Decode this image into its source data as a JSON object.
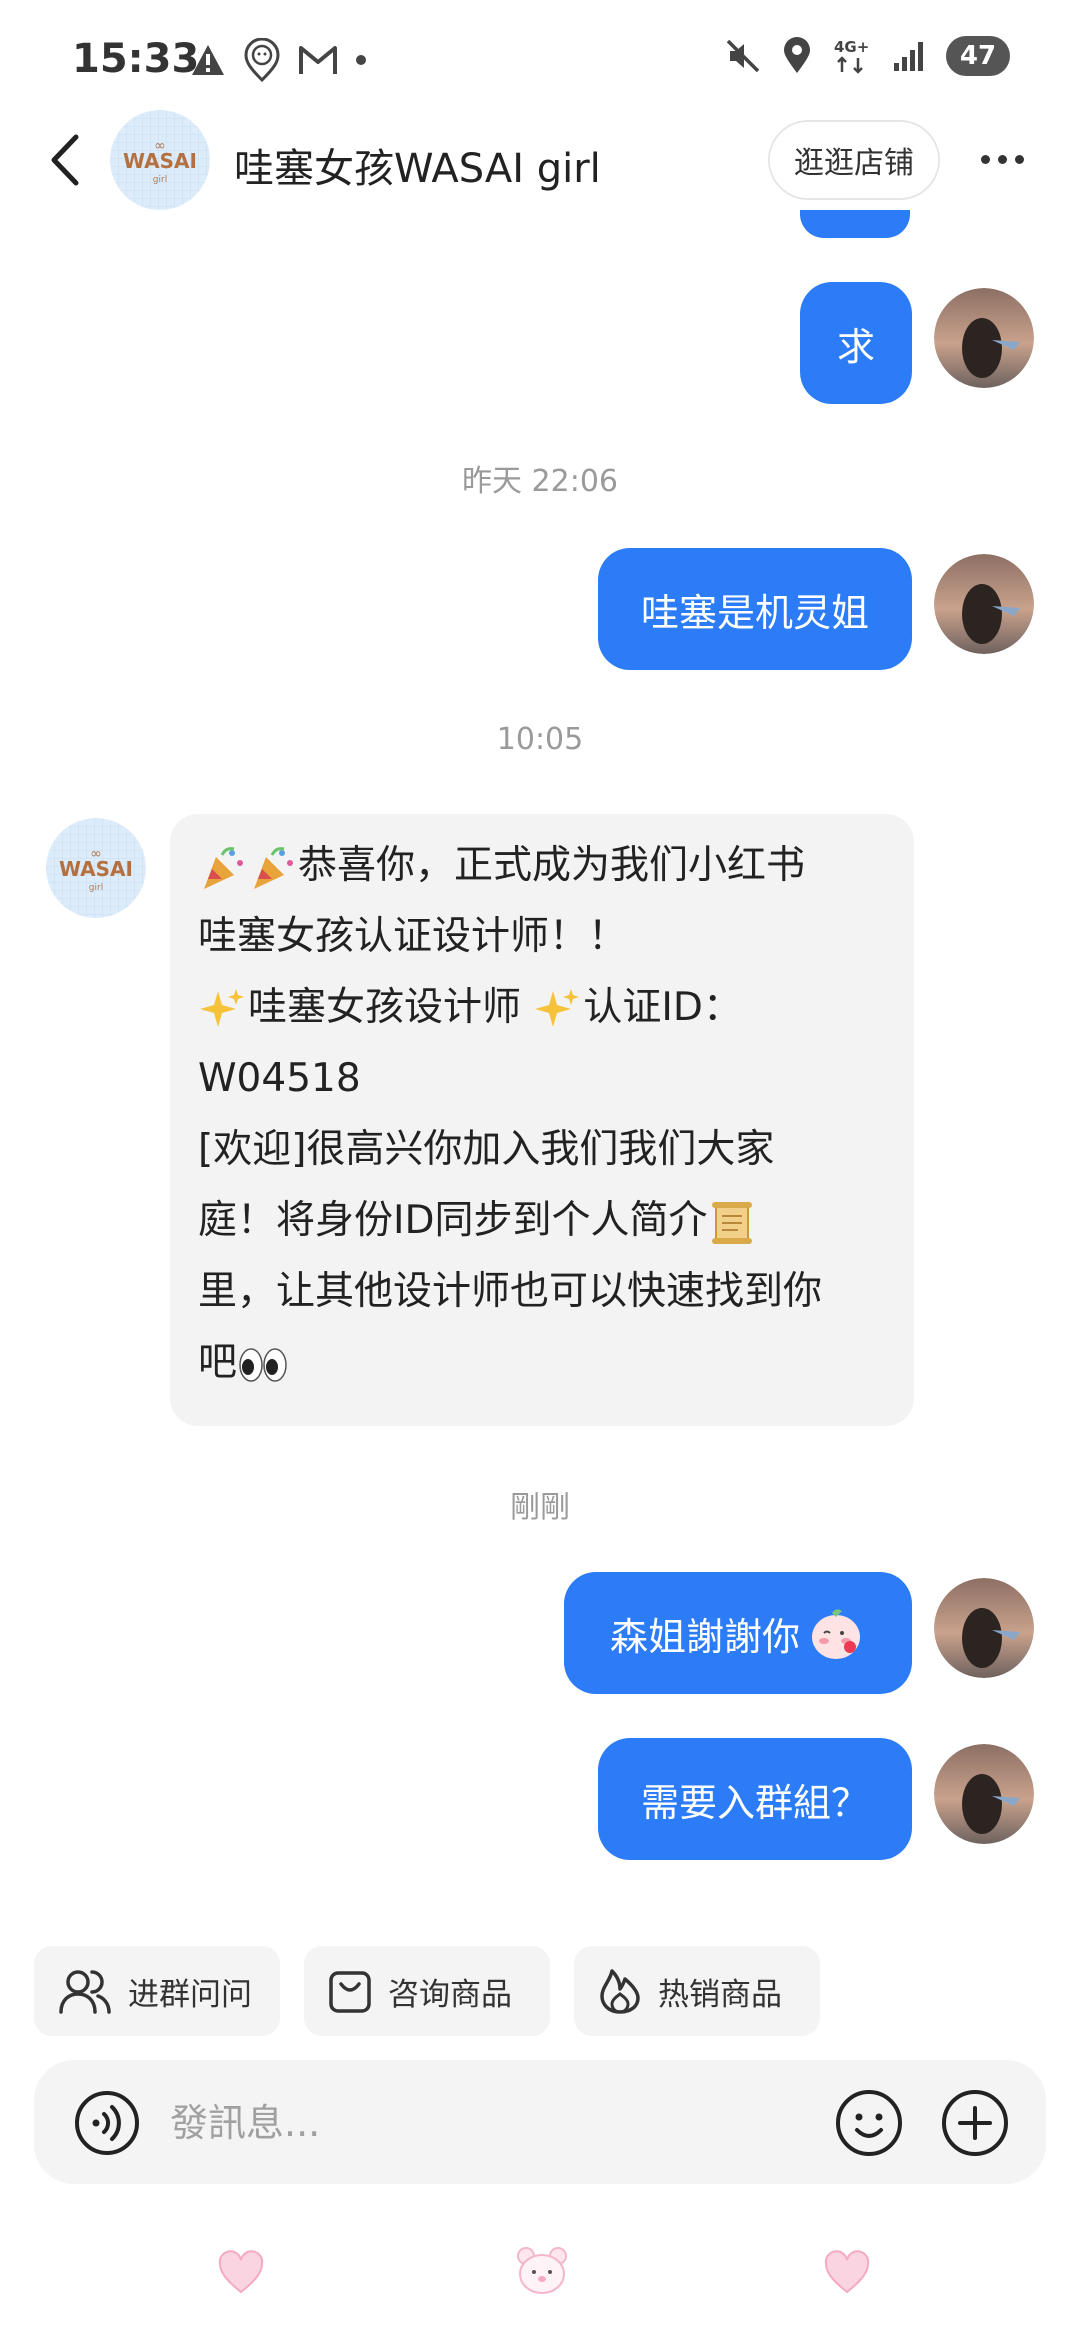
{
  "status_bar": {
    "time": "15:33",
    "battery": "47",
    "network": "4G+"
  },
  "header": {
    "title": "哇塞女孩WASAI girl",
    "shop_button": "逛逛店铺",
    "avatar_text": "WASAI",
    "avatar_sub": "girl"
  },
  "messages": {
    "m1": {
      "text": "求"
    },
    "t1": "昨天 22:06",
    "m2": {
      "text": "哇塞是机灵姐"
    },
    "t2": "10:05",
    "m3": {
      "line1": "恭喜你，正式成为我们小红书",
      "line2": "哇塞女孩认证设计师！！",
      "line3a": "哇塞女孩设计师 ",
      "line3b": "认证ID：",
      "line4": "W04518",
      "line5": "[欢迎]很高兴你加入我们我们大家",
      "line6": "庭！将身份ID同步到个人简介",
      "line7": "里，让其他设计师也可以快速找到你",
      "line8": "吧"
    },
    "t3": "剛剛",
    "m4": {
      "text": "森姐謝謝你"
    },
    "m5": {
      "text": "需要入群組？"
    }
  },
  "quick_actions": [
    {
      "label": "进群问问",
      "icon": "group-icon"
    },
    {
      "label": "咨询商品",
      "icon": "bag-icon"
    },
    {
      "label": "热销商品",
      "icon": "fire-icon"
    }
  ],
  "input": {
    "placeholder": "發訊息..."
  },
  "colors": {
    "bubble_blue": "#2b7cf6",
    "bubble_gray": "#f3f3f3"
  }
}
